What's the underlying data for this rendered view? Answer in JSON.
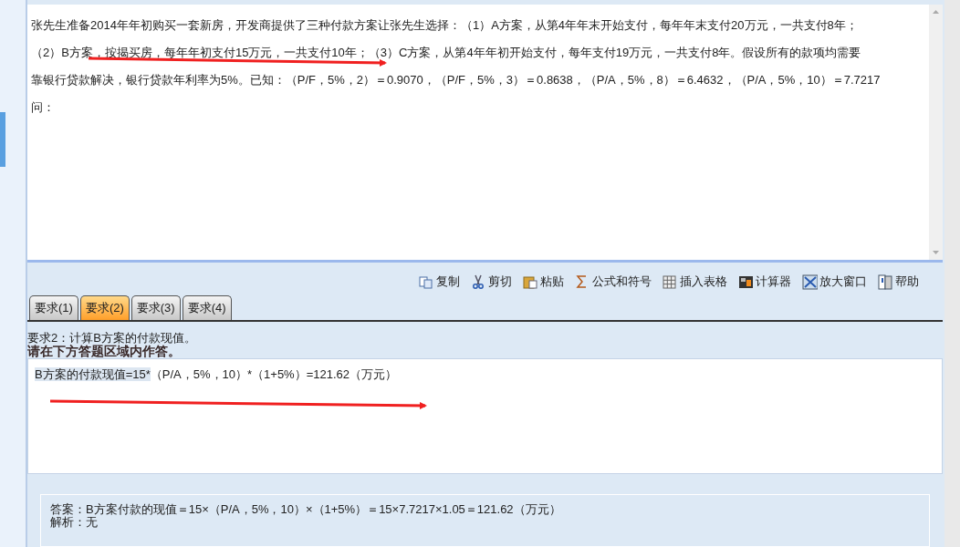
{
  "question": {
    "lines": [
      "张先生准备2014年年初购买一套新房，开发商提供了三种付款方案让张先生选择：（1）A方案，从第4年年末开始支付，每年年末支付20万元，一共支付8年；",
      "（2）B方案，按揭买房，每年年初支付15万元，一共支付10年；（3）C方案，从第4年年初开始支付，每年支付19万元，一共支付8年。假设所有的款项均需要",
      "靠银行贷款解决，银行贷款年利率为5%。已知：（P/F，5%，2）＝0.9070，（P/F，5%，3）＝0.8638，（P/A，5%，8）＝6.4632，（P/A，5%，10）＝7.7217"
    ],
    "prompt": "问："
  },
  "toolbar": [
    {
      "kind": "copy",
      "label": "复制"
    },
    {
      "kind": "cut",
      "label": "剪切"
    },
    {
      "kind": "paste",
      "label": "粘贴"
    },
    {
      "kind": "sigma",
      "label": "公式和符号"
    },
    {
      "kind": "table",
      "label": "插入表格"
    },
    {
      "kind": "calculator",
      "label": "计算器"
    },
    {
      "kind": "maximize",
      "label": "放大窗口"
    },
    {
      "kind": "help",
      "label": "帮助"
    }
  ],
  "tabs": [
    {
      "label": "要求(1)",
      "selected": false
    },
    {
      "label": "要求(2)",
      "selected": true
    },
    {
      "label": "要求(3)",
      "selected": false
    },
    {
      "label": "要求(4)",
      "selected": false
    }
  ],
  "requirement": "要求2：计算B方案的付款现值。",
  "instruction": "请在下方答题区域内作答。",
  "answer_field": {
    "parts": [
      {
        "text": "B方案的付款现值=15*",
        "selected": true
      },
      {
        "text": "（P/A，5%，10）*（1+5%）=121.62（万元）",
        "selected": false
      }
    ]
  },
  "solution": {
    "answer": "答案：B方案付款的现值＝15×（P/A，5%，10）×（1+5%）＝15×7.7217×1.05＝121.62（万元）",
    "analysis": "解析：无"
  },
  "annotations": [
    {
      "kind": "arrow"
    },
    {
      "kind": "arrow"
    }
  ]
}
